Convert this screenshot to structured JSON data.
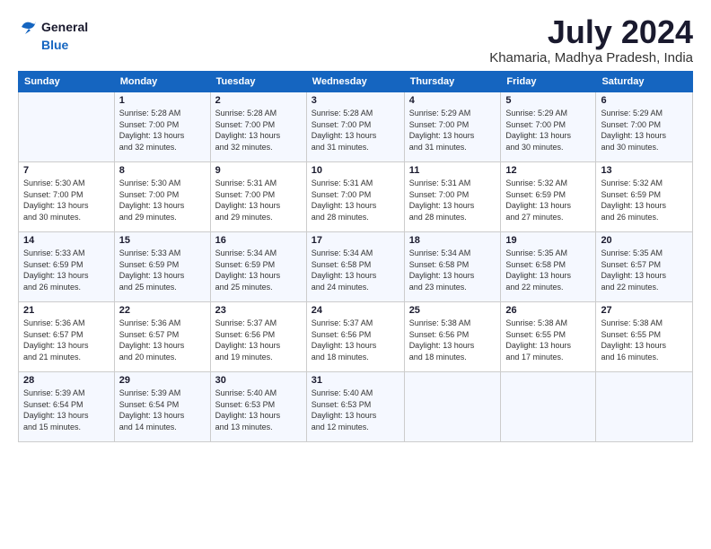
{
  "header": {
    "logo_line1": "General",
    "logo_line2": "Blue",
    "month_title": "July 2024",
    "location": "Khamaria, Madhya Pradesh, India"
  },
  "days_of_week": [
    "Sunday",
    "Monday",
    "Tuesday",
    "Wednesday",
    "Thursday",
    "Friday",
    "Saturday"
  ],
  "weeks": [
    [
      {
        "day": "",
        "info": ""
      },
      {
        "day": "1",
        "info": "Sunrise: 5:28 AM\nSunset: 7:00 PM\nDaylight: 13 hours\nand 32 minutes."
      },
      {
        "day": "2",
        "info": "Sunrise: 5:28 AM\nSunset: 7:00 PM\nDaylight: 13 hours\nand 32 minutes."
      },
      {
        "day": "3",
        "info": "Sunrise: 5:28 AM\nSunset: 7:00 PM\nDaylight: 13 hours\nand 31 minutes."
      },
      {
        "day": "4",
        "info": "Sunrise: 5:29 AM\nSunset: 7:00 PM\nDaylight: 13 hours\nand 31 minutes."
      },
      {
        "day": "5",
        "info": "Sunrise: 5:29 AM\nSunset: 7:00 PM\nDaylight: 13 hours\nand 30 minutes."
      },
      {
        "day": "6",
        "info": "Sunrise: 5:29 AM\nSunset: 7:00 PM\nDaylight: 13 hours\nand 30 minutes."
      }
    ],
    [
      {
        "day": "7",
        "info": "Sunrise: 5:30 AM\nSunset: 7:00 PM\nDaylight: 13 hours\nand 30 minutes."
      },
      {
        "day": "8",
        "info": "Sunrise: 5:30 AM\nSunset: 7:00 PM\nDaylight: 13 hours\nand 29 minutes."
      },
      {
        "day": "9",
        "info": "Sunrise: 5:31 AM\nSunset: 7:00 PM\nDaylight: 13 hours\nand 29 minutes."
      },
      {
        "day": "10",
        "info": "Sunrise: 5:31 AM\nSunset: 7:00 PM\nDaylight: 13 hours\nand 28 minutes."
      },
      {
        "day": "11",
        "info": "Sunrise: 5:31 AM\nSunset: 7:00 PM\nDaylight: 13 hours\nand 28 minutes."
      },
      {
        "day": "12",
        "info": "Sunrise: 5:32 AM\nSunset: 6:59 PM\nDaylight: 13 hours\nand 27 minutes."
      },
      {
        "day": "13",
        "info": "Sunrise: 5:32 AM\nSunset: 6:59 PM\nDaylight: 13 hours\nand 26 minutes."
      }
    ],
    [
      {
        "day": "14",
        "info": "Sunrise: 5:33 AM\nSunset: 6:59 PM\nDaylight: 13 hours\nand 26 minutes."
      },
      {
        "day": "15",
        "info": "Sunrise: 5:33 AM\nSunset: 6:59 PM\nDaylight: 13 hours\nand 25 minutes."
      },
      {
        "day": "16",
        "info": "Sunrise: 5:34 AM\nSunset: 6:59 PM\nDaylight: 13 hours\nand 25 minutes."
      },
      {
        "day": "17",
        "info": "Sunrise: 5:34 AM\nSunset: 6:58 PM\nDaylight: 13 hours\nand 24 minutes."
      },
      {
        "day": "18",
        "info": "Sunrise: 5:34 AM\nSunset: 6:58 PM\nDaylight: 13 hours\nand 23 minutes."
      },
      {
        "day": "19",
        "info": "Sunrise: 5:35 AM\nSunset: 6:58 PM\nDaylight: 13 hours\nand 22 minutes."
      },
      {
        "day": "20",
        "info": "Sunrise: 5:35 AM\nSunset: 6:57 PM\nDaylight: 13 hours\nand 22 minutes."
      }
    ],
    [
      {
        "day": "21",
        "info": "Sunrise: 5:36 AM\nSunset: 6:57 PM\nDaylight: 13 hours\nand 21 minutes."
      },
      {
        "day": "22",
        "info": "Sunrise: 5:36 AM\nSunset: 6:57 PM\nDaylight: 13 hours\nand 20 minutes."
      },
      {
        "day": "23",
        "info": "Sunrise: 5:37 AM\nSunset: 6:56 PM\nDaylight: 13 hours\nand 19 minutes."
      },
      {
        "day": "24",
        "info": "Sunrise: 5:37 AM\nSunset: 6:56 PM\nDaylight: 13 hours\nand 18 minutes."
      },
      {
        "day": "25",
        "info": "Sunrise: 5:38 AM\nSunset: 6:56 PM\nDaylight: 13 hours\nand 18 minutes."
      },
      {
        "day": "26",
        "info": "Sunrise: 5:38 AM\nSunset: 6:55 PM\nDaylight: 13 hours\nand 17 minutes."
      },
      {
        "day": "27",
        "info": "Sunrise: 5:38 AM\nSunset: 6:55 PM\nDaylight: 13 hours\nand 16 minutes."
      }
    ],
    [
      {
        "day": "28",
        "info": "Sunrise: 5:39 AM\nSunset: 6:54 PM\nDaylight: 13 hours\nand 15 minutes."
      },
      {
        "day": "29",
        "info": "Sunrise: 5:39 AM\nSunset: 6:54 PM\nDaylight: 13 hours\nand 14 minutes."
      },
      {
        "day": "30",
        "info": "Sunrise: 5:40 AM\nSunset: 6:53 PM\nDaylight: 13 hours\nand 13 minutes."
      },
      {
        "day": "31",
        "info": "Sunrise: 5:40 AM\nSunset: 6:53 PM\nDaylight: 13 hours\nand 12 minutes."
      },
      {
        "day": "",
        "info": ""
      },
      {
        "day": "",
        "info": ""
      },
      {
        "day": "",
        "info": ""
      }
    ]
  ]
}
